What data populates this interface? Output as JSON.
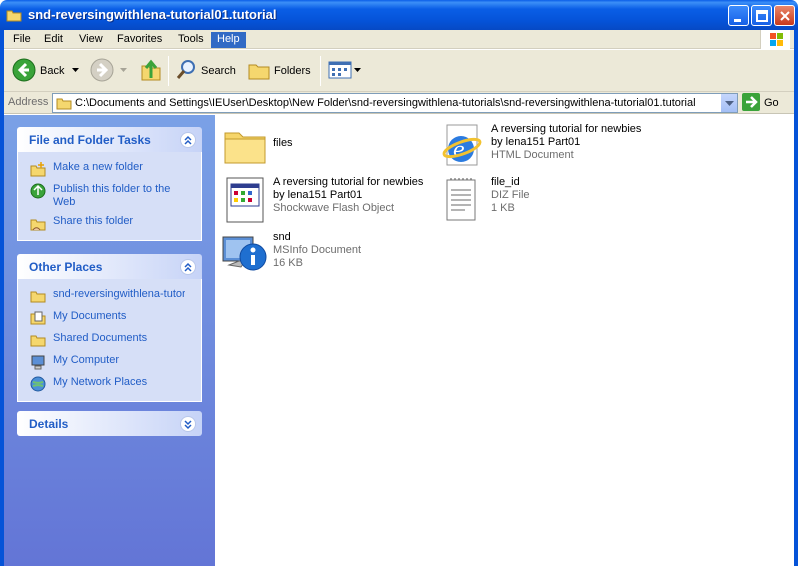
{
  "window": {
    "title": "snd-reversingwithlena-tutorial01.tutorial"
  },
  "menu": [
    "File",
    "Edit",
    "View",
    "Favorites",
    "Tools",
    "Help"
  ],
  "toolbar": {
    "back": "Back",
    "search": "Search",
    "folders": "Folders"
  },
  "address": {
    "label": "Address",
    "path": "C:\\Documents and Settings\\IEUser\\Desktop\\New Folder\\snd-reversingwithlena-tutorials\\snd-reversingwithlena-tutorial01.tutorial",
    "go": "Go"
  },
  "tasks_panel": {
    "title": "File and Folder Tasks",
    "items": [
      {
        "line1": "Make a new folder",
        "line2": ""
      },
      {
        "line1": "Publish this folder to the",
        "line2": "Web"
      },
      {
        "line1": "Share this folder",
        "line2": ""
      }
    ]
  },
  "places_panel": {
    "title": "Other Places",
    "items": [
      "snd-reversingwithlena-tutorials",
      "My Documents",
      "Shared Documents",
      "My Computer",
      "My Network Places"
    ]
  },
  "details_panel": {
    "title": "Details"
  },
  "files": [
    {
      "line1": "files",
      "line2": "",
      "line3": "",
      "icon": "folder-icon"
    },
    {
      "line1": "A reversing tutorial for newbies",
      "line2": "by lena151 Part01",
      "line3": "HTML Document",
      "icon": "ie-html-icon"
    },
    {
      "line1": "A reversing tutorial for newbies",
      "line2": "by lena151 Part01",
      "line3": "Shockwave Flash Object",
      "icon": "flash-object-icon"
    },
    {
      "line1": "file_id",
      "line2": "DIZ File",
      "line3": "1 KB",
      "icon": "text-file-icon"
    },
    {
      "line1": "snd",
      "line2": "MSInfo Document",
      "line3": "16 KB",
      "icon": "msinfo-icon"
    }
  ]
}
